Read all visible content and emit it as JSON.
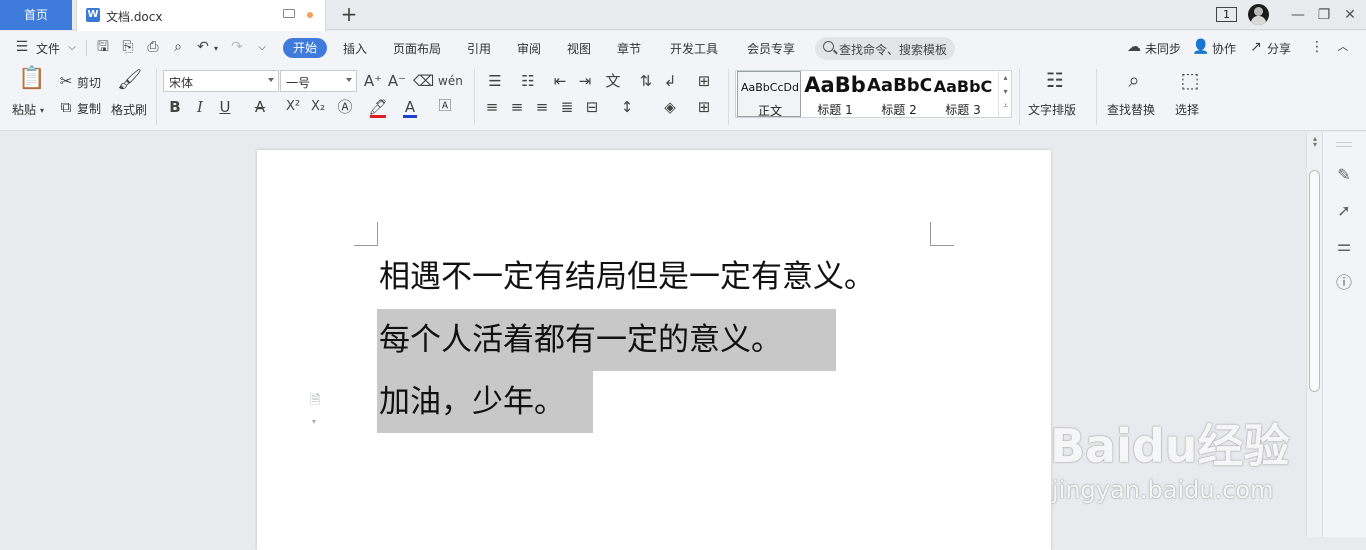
{
  "tabs": {
    "home": "首页",
    "document": "文档.docx",
    "new_tab": "+"
  },
  "window": {
    "badge": "1"
  },
  "menu": {
    "file": "文件",
    "items": [
      "开始",
      "插入",
      "页面布局",
      "引用",
      "审阅",
      "视图",
      "章节",
      "开发工具",
      "会员专享"
    ],
    "search_placeholder": "查找命令、搜索模板",
    "right": [
      "未同步",
      "协作",
      "分享"
    ]
  },
  "toolbar": {
    "paste": "粘贴",
    "cut": "剪切",
    "copy": "复制",
    "format_painter": "格式刷",
    "font_name": "宋体",
    "font_size": "一号",
    "styles": [
      {
        "sample": "AaBbCcDd",
        "name": "正文"
      },
      {
        "sample": "AaBb",
        "name": "标题 1"
      },
      {
        "sample": "AaBbC",
        "name": "标题 2"
      },
      {
        "sample": "AaBbC",
        "name": "标题 3"
      }
    ],
    "text_layout": "文字排版",
    "find_replace": "查找替换",
    "select": "选择"
  },
  "document": {
    "lines": [
      "相遇不一定有结局但是一定有意义。",
      "每个人活着都有一定的意义。",
      "加油，少年。"
    ]
  },
  "watermark": {
    "brand": "Baidu经验",
    "url": "jingyan.baidu.com"
  },
  "colors": {
    "accent": "#3e7bdb",
    "selection": "#c8c8c8",
    "font_color_red": "#e02020",
    "font_color_blue": "#2040d0"
  }
}
